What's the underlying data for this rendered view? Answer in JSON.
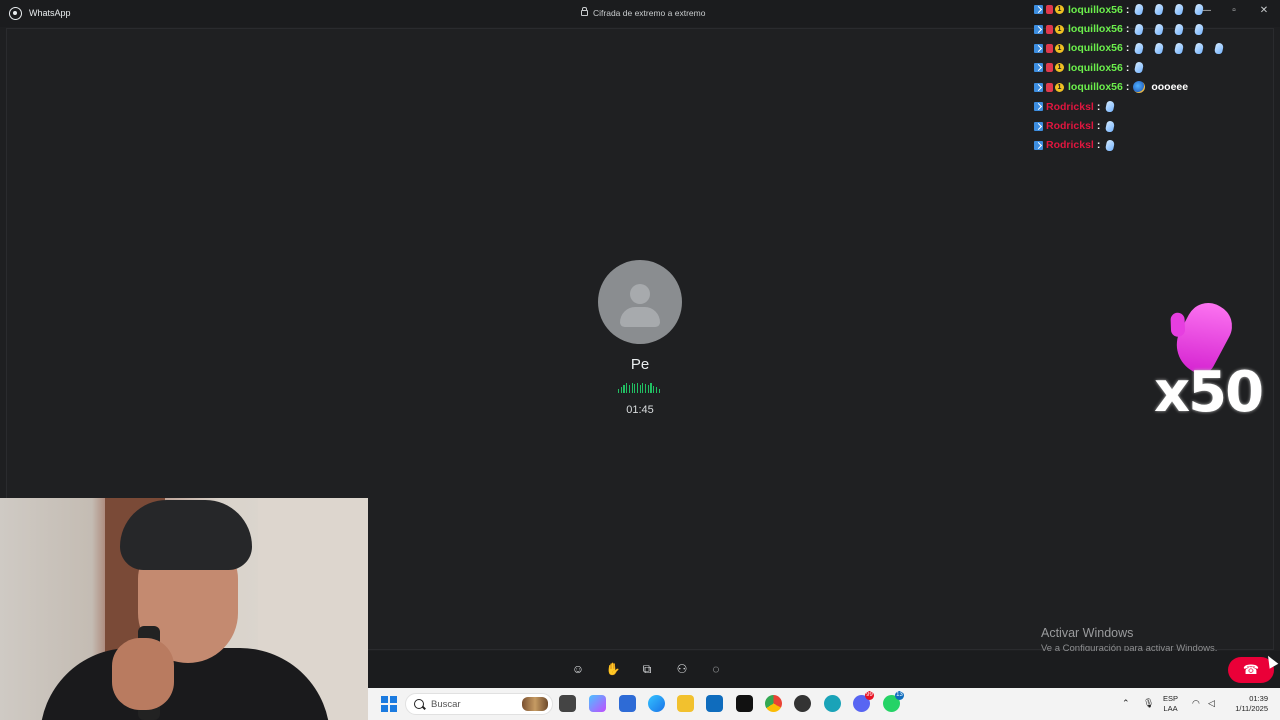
{
  "titlebar": {
    "app_name": "WhatsApp",
    "encryption": "Cifrada de extremo a extremo",
    "minimize": "—",
    "maximize": "▫",
    "close": "✕"
  },
  "call": {
    "contact_name": "Pe",
    "duration": "01:45"
  },
  "chat": [
    {
      "user": "loquillox56",
      "user_color": "#6cf04c",
      "emotes": 4,
      "text": ""
    },
    {
      "user": "loquillox56",
      "user_color": "#6cf04c",
      "emotes": 4,
      "text": ""
    },
    {
      "user": "loquillox56",
      "user_color": "#6cf04c",
      "emotes": 5,
      "text": ""
    },
    {
      "user": "loquillox56",
      "user_color": "#6cf04c",
      "emotes": 1,
      "text": ""
    },
    {
      "user": "loquillox56",
      "user_color": "#6cf04c",
      "emotes": 0,
      "text": "oooeee"
    },
    {
      "user": "Rodricksl",
      "user_color": "#e0163f",
      "emotes": 1,
      "text": ""
    },
    {
      "user": "Rodricksl",
      "user_color": "#e0163f",
      "emotes": 1,
      "text": ""
    },
    {
      "user": "Rodricksl",
      "user_color": "#e0163f",
      "emotes": 1,
      "text": ""
    }
  ],
  "combo": {
    "text": "x50"
  },
  "activation": {
    "title": "Activar Windows",
    "subtitle": "Ve a Configuración para activar Windows."
  },
  "controls": {
    "icons": [
      "emoji-icon",
      "raise-hand-icon",
      "share-screen-icon",
      "add-person-icon",
      "chat-icon"
    ],
    "end_call_icon": "hang-up-icon"
  },
  "taskbar": {
    "search_placeholder": "Buscar",
    "lang_line1": "ESP",
    "lang_line2": "LAA",
    "time": "01:39",
    "date": "1/11/2025",
    "badge_discord": "99",
    "badge_whatsapp": "13"
  },
  "colors": {
    "accent_green": "#21c063",
    "end_call_red": "#ea0038",
    "windows_blue": "#1b7be0"
  }
}
